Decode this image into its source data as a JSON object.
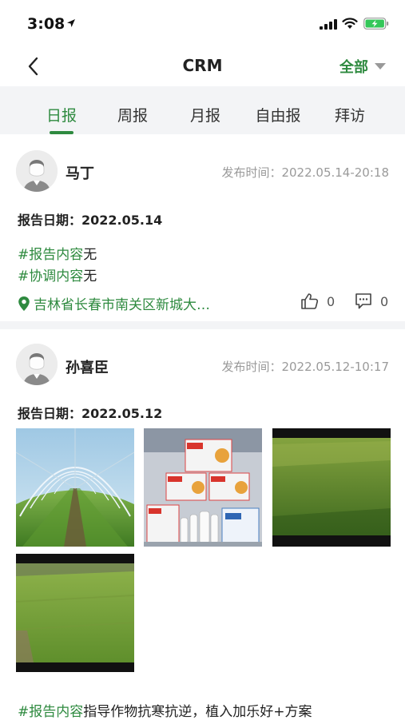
{
  "status": {
    "time": "3:08"
  },
  "nav": {
    "title": "CRM",
    "filter_label": "全部"
  },
  "tabs": [
    "日报",
    "周报",
    "月报",
    "自由报",
    "拜访"
  ],
  "reports": [
    {
      "author": "马丁",
      "publish_time": "发布时间：2022.05.14-20:18",
      "date_label": "报告日期：",
      "date_value": "2022.05.14",
      "content_tag": "#报告内容",
      "content_text": "无",
      "coord_tag": "#协调内容",
      "coord_text": "无",
      "location": "吉林省长春市南关区新城大…",
      "likes": "0",
      "comments": "0"
    },
    {
      "author": "孙喜臣",
      "publish_time": "发布时间：2022.05.12-10:17",
      "date_label": "报告日期：",
      "date_value": "2022.05.12",
      "content_tag": "#报告内容",
      "content_text": "指导作物抗寒抗逆，植入加乐好+方案"
    }
  ],
  "icons": {
    "back": "chevron-left-icon",
    "filter": "caret-down-icon",
    "location": "location-pin-icon",
    "like": "thumbs-up-icon",
    "comment": "comment-icon"
  },
  "colors": {
    "accent": "#2e8a3f",
    "muted": "#9a9a9a",
    "tab_bg": "#f3f4f6"
  }
}
